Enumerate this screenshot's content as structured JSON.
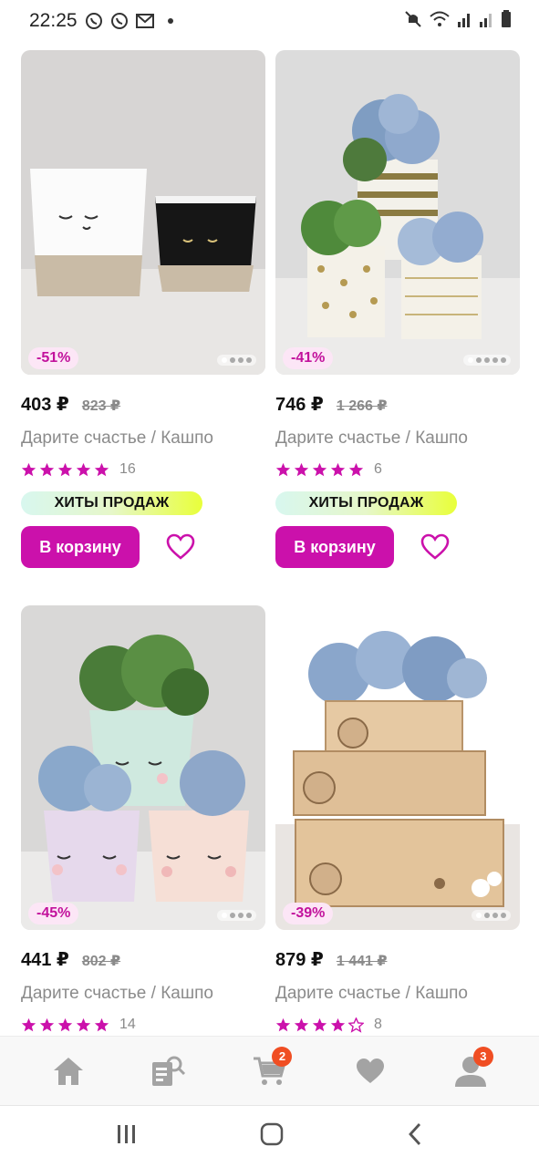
{
  "status_bar": {
    "time": "22:25"
  },
  "products": [
    {
      "discount": "-51%",
      "price": "403 ₽",
      "old_price": "823 ₽",
      "brand": "Дарите счастье / Кашпо",
      "rating": 5,
      "reviews": "16",
      "hit_label": "ХИТЫ ПРОДАЖ",
      "cart_label": "В корзину"
    },
    {
      "discount": "-41%",
      "price": "746 ₽",
      "old_price": "1 266 ₽",
      "brand": "Дарите счастье / Кашпо",
      "rating": 5,
      "reviews": "6",
      "hit_label": "ХИТЫ ПРОДАЖ",
      "cart_label": "В корзину"
    },
    {
      "discount": "-45%",
      "price": "441 ₽",
      "old_price": "802 ₽",
      "brand": "Дарите счастье / Кашпо",
      "rating": 5,
      "reviews": "14"
    },
    {
      "discount": "-39%",
      "price": "879 ₽",
      "old_price": "1 441 ₽",
      "brand": "Дарите счастье / Кашпо",
      "rating": 4,
      "reviews": "8"
    }
  ],
  "bottom_nav": {
    "items": [
      {
        "icon": "home-icon"
      },
      {
        "icon": "catalog-search-icon"
      },
      {
        "icon": "cart-icon",
        "badge": "2"
      },
      {
        "icon": "heart-icon"
      },
      {
        "icon": "profile-icon",
        "badge": "3"
      }
    ]
  },
  "colors": {
    "accent": "#cb11ab",
    "badge": "#f04e23",
    "star": "#cb11ab"
  }
}
